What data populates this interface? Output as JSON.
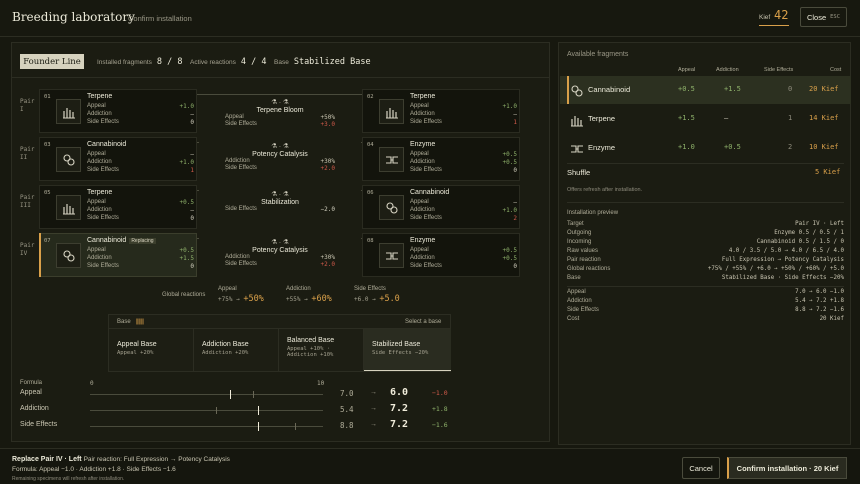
{
  "header": {
    "title": "Breeding laboratory",
    "subtitle": "Confirm installation",
    "kief_label": "Kief",
    "kief_value": "42",
    "close_label": "Close",
    "close_key": "ESC"
  },
  "lineup": {
    "line_name": "Founder Line",
    "installed_label": "Installed fragments",
    "installed_value": "8 / 8",
    "reactions_label": "Active reactions",
    "reactions_value": "4 / 4",
    "base_label": "Base",
    "base_value": "Stabilized Base"
  },
  "pairs": [
    {
      "label": "Pair\nI",
      "left": {
        "num": "01",
        "name": "Terpene",
        "icon": "terpene-icon",
        "appeal": "+1.0",
        "addiction": "–",
        "side": "0"
      },
      "right": {
        "num": "02",
        "name": "Terpene",
        "icon": "terpene-icon",
        "appeal": "+1.0",
        "addiction": "–",
        "side": "1"
      },
      "reaction": {
        "syms": "",
        "name": "Terpene Bloom",
        "rows": [
          {
            "k": "Appeal",
            "v": "+50%"
          },
          {
            "k": "Side Effects",
            "v": "+3.0"
          }
        ]
      }
    },
    {
      "label": "Pair\nII",
      "left": {
        "num": "03",
        "name": "Cannabinoid",
        "icon": "cannabinoid-icon",
        "appeal": "–",
        "addiction": "+1.0",
        "side": "1"
      },
      "right": {
        "num": "04",
        "name": "Enzyme",
        "icon": "enzyme-icon",
        "appeal": "+0.5",
        "addiction": "+0.5",
        "side": "0"
      },
      "reaction": {
        "syms": "⚗ · ⚗",
        "name": "Potency Catalysis",
        "rows": [
          {
            "k": "Addiction",
            "v": "+30%"
          },
          {
            "k": "Side Effects",
            "v": "+2.0"
          }
        ]
      }
    },
    {
      "label": "Pair\nIII",
      "left": {
        "num": "05",
        "name": "Terpene",
        "icon": "terpene-icon",
        "appeal": "+0.5",
        "addiction": "–",
        "side": "0"
      },
      "right": {
        "num": "06",
        "name": "Cannabinoid",
        "icon": "cannabinoid-icon",
        "appeal": "–",
        "addiction": "+1.0",
        "side": "2"
      },
      "reaction": {
        "syms": "⚗ · ⚗",
        "name": "Stabilization",
        "rows": [
          {
            "k": "Side Effects",
            "v": "−2.0"
          }
        ]
      }
    },
    {
      "label": "Pair\nIV",
      "left": {
        "num": "07",
        "name": "Cannabinoid",
        "tag": "Replacing",
        "icon": "cannabinoid-icon",
        "appeal": "+0.5",
        "addiction": "+1.5",
        "side": "0"
      },
      "right": {
        "num": "08",
        "name": "Enzyme",
        "icon": "enzyme-icon",
        "appeal": "+0.5",
        "addiction": "+0.5",
        "side": "0"
      },
      "reaction": {
        "syms": "⚗ · ⚗",
        "name": "Potency Catalysis",
        "rows": [
          {
            "k": "Addiction",
            "v": "+30%"
          },
          {
            "k": "Side Effects",
            "v": "+2.0"
          }
        ]
      }
    }
  ],
  "stat_labels": {
    "appeal": "Appeal",
    "addiction": "Addiction",
    "side": "Side Effects"
  },
  "global": {
    "label": "Global reactions",
    "appeal": {
      "k": "Appeal",
      "from": "+75%",
      "arrow": "→",
      "to": "+50%"
    },
    "addiction": {
      "k": "Addiction",
      "from": "+55%",
      "arrow": "→",
      "to": "+60%"
    },
    "side": {
      "k": "Side Effects",
      "from": "+6.0",
      "arrow": "→",
      "to": "+5.0"
    }
  },
  "bases": {
    "label": "Base",
    "select_label": "Select a base",
    "options": [
      {
        "title": "Appeal Base",
        "sub": "Appeal +20%"
      },
      {
        "title": "Addiction Base",
        "sub": "Addiction +20%"
      },
      {
        "title": "Balanced Base",
        "sub": "Appeal +10% ·\nAddiction +10%"
      },
      {
        "title": "Stabilized Base",
        "sub": "Side Effects −20%"
      }
    ],
    "selected_index": 3
  },
  "formula": {
    "label": "Formula",
    "scale_min": "0",
    "scale_max": "10",
    "rows": [
      {
        "label": "Appeal",
        "old": "7.0",
        "arrow": "→",
        "new": "6.0",
        "delta": "−1.0",
        "delta_sign": "neg",
        "old_value": 7.0,
        "new_value": 6.0
      },
      {
        "label": "Addiction",
        "old": "5.4",
        "arrow": "→",
        "new": "7.2",
        "delta": "+1.8",
        "delta_sign": "pos",
        "old_value": 5.4,
        "new_value": 7.2
      },
      {
        "label": "Side Effects",
        "old": "8.8",
        "arrow": "→",
        "new": "7.2",
        "delta": "−1.6",
        "delta_sign": "pos",
        "old_value": 8.8,
        "new_value": 7.2
      }
    ]
  },
  "available": {
    "title": "Available fragments",
    "cols": {
      "appeal": "Appeal",
      "addiction": "Addiction",
      "side": "Side Effects",
      "cost": "Cost"
    },
    "items": [
      {
        "name": "Cannabinoid",
        "icon": "cannabinoid-icon",
        "appeal": "+0.5",
        "addiction": "+1.5",
        "side": "0",
        "cost": "20 Kief"
      },
      {
        "name": "Terpene",
        "icon": "terpene-icon",
        "appeal": "+1.5",
        "addiction": "–",
        "side": "1",
        "cost": "14 Kief"
      },
      {
        "name": "Enzyme",
        "icon": "enzyme-icon",
        "appeal": "+1.0",
        "addiction": "+0.5",
        "side": "2",
        "cost": "10 Kief"
      }
    ],
    "shuffle_label": "Shuffle",
    "shuffle_cost": "5 Kief",
    "shuffle_note": "Offers refresh after installation."
  },
  "preview": {
    "title": "Installation preview",
    "rows": [
      {
        "k": "Target",
        "v": "Pair IV · Left"
      },
      {
        "k": "Outgoing",
        "v": "Enzyme  0.5 / 0.5 / 1"
      },
      {
        "k": "Incoming",
        "v": "Cannabinoid  0.5 / 1.5 / 0"
      },
      {
        "k": "Raw values",
        "v": "4.0 / 3.5 / 5.0 → 4.0 / 6.5 / 4.0"
      },
      {
        "k": "Pair reaction",
        "v": "Full Expression → Potency Catalysis"
      },
      {
        "k": "Global reactions",
        "v": "+75% / +55% / +6.0 → +50% / +60% / +5.0"
      },
      {
        "k": "Base",
        "v": "Stabilized Base · Side Effects −20%"
      }
    ],
    "result_rows": [
      {
        "k": "Appeal",
        "v": "7.0 → 6.0  −1.0"
      },
      {
        "k": "Addiction",
        "v": "5.4 → 7.2  +1.8"
      },
      {
        "k": "Side Effects",
        "v": "8.8 → 7.2  −1.6"
      },
      {
        "k": "Cost",
        "v": "20 Kief"
      }
    ]
  },
  "footer": {
    "title": "Replace Pair IV · Left",
    "reaction_text": "Pair reaction: Full Expression → Potency Catalysis",
    "formula_text": "Formula: Appeal −1.0 · Addiction +1.8 · Side Effects −1.6",
    "note": "Remaining specimens will refresh after installation.",
    "cancel_label": "Cancel",
    "confirm_label": "Confirm installation · 20 Kief"
  },
  "colors": {
    "accent": "#d9a04a",
    "positive": "#8fb26b",
    "negative": "#d05a4a",
    "background": "#17180f"
  }
}
